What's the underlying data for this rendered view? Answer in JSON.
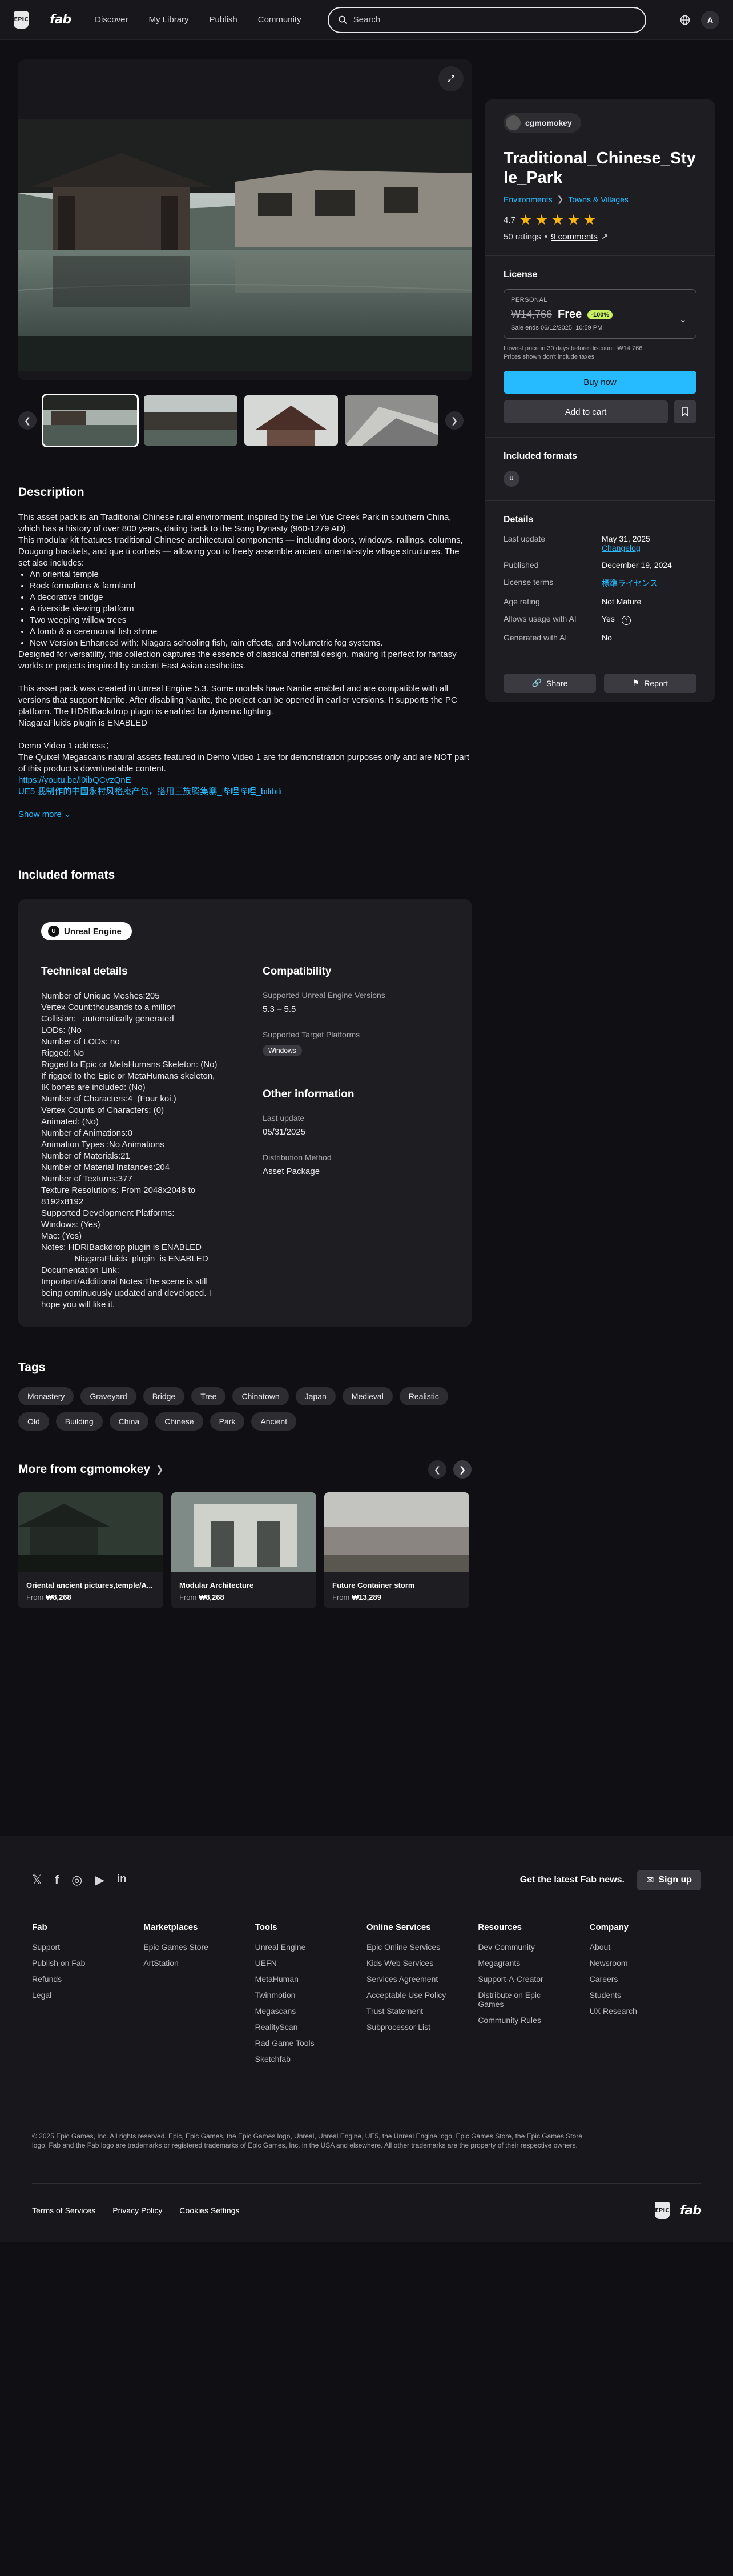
{
  "header": {
    "epic_logo_text": "EPIC",
    "fab_logo_text": "fab",
    "nav": [
      "Discover",
      "My Library",
      "Publish",
      "Community"
    ],
    "search_placeholder": "Search",
    "avatar_letter": "A"
  },
  "gallery": {
    "expand_icon": "expand-icon"
  },
  "description": {
    "title": "Description",
    "p1": "This asset pack is an Traditional Chinese rural environment, inspired by the Lei Yue Creek Park in southern China, which has a history of over 800 years, dating back to the Song Dynasty (960-1279 AD).",
    "p2": "This modular kit features traditional Chinese architectural components — including doors, windows, railings, columns, Dougong brackets, and que ti corbels — allowing you to freely assemble ancient oriental-style village structures. The set also includes:",
    "bullets": [
      "An oriental temple",
      "Rock formations & farmland",
      "A decorative bridge",
      "A riverside viewing platform",
      "Two weeping willow trees",
      "A tomb & a ceremonial fish shrine",
      "New Version Enhanced with: Niagara schooling fish, rain effects, and volumetric fog systems."
    ],
    "p3": "Designed for versatility, this collection captures the essence of classical oriental design, making it perfect for fantasy worlds or projects inspired by ancient East Asian aesthetics.",
    "p4": "This asset pack was created in Unreal Engine 5.3. Some models have Nanite enabled and are compatible with all versions that support Nanite. After disabling Nanite, the project can be opened in earlier versions. It supports the PC platform. The HDRIBackdrop plugin is enabled for dynamic lighting.",
    "p5": "NiagaraFluids  plugin  is ENABLED",
    "p6": "Demo Video 1 address：",
    "p7": " The Quixel Megascans natural assets featured in Demo Video 1 are for demonstration purposes only and are NOT part of this product's downloadable content.",
    "link1": "https://youtu.be/l0ibQCvzQnE",
    "link2": "UE5 我制作的中国永村风格庵产包，搭用三族腾集寨_哔哩哔哩_bilibili",
    "show_more": "Show more"
  },
  "included": {
    "title": "Included formats",
    "engine": "Unreal Engine",
    "engine_icon_text": "U",
    "tech_title": "Technical details",
    "tech_text": "Number of Unique Meshes:205\nVertex Count:thousands to a million\nCollision:   automatically generated\nLODs: (No\nNumber of LODs: no\nRigged: No\nRigged to Epic or MetaHumans Skeleton: (No)\nIf rigged to the Epic or MetaHumans skeleton, IK bones are included: (No)\nNumber of Characters:4  (Four koi.)\nVertex Counts of Characters: (0)\nAnimated: (No)\nNumber of Animations:0\nAnimation Types :No Animations\nNumber of Materials:21\nNumber of Material Instances:204\nNumber of Textures:377\nTexture Resolutions: From 2048x2048 to 8192x8192\nSupported Development Platforms:\nWindows: (Yes)\nMac: (Yes)\nNotes: HDRIBackdrop plugin is ENABLED\n              NiagaraFluids  plugin  is ENABLED\nDocumentation Link:\nImportant/Additional Notes:The scene is still being continuously updated and developed. I hope you will like it.",
    "compat_title": "Compatibility",
    "ue_versions_label": "Supported Unreal Engine Versions",
    "ue_versions": "5.3 – 5.5",
    "platforms_label": "Supported Target Platforms",
    "platform": "Windows",
    "other_title": "Other information",
    "last_update_label": "Last update",
    "last_update": "05/31/2025",
    "distribution_label": "Distribution Method",
    "distribution": "Asset Package"
  },
  "tags": {
    "title": "Tags",
    "items": [
      "Monastery",
      "Graveyard",
      "Bridge",
      "Tree",
      "Chinatown",
      "Japan",
      "Medieval",
      "Realistic",
      "Old",
      "Building",
      "China",
      "Chinese",
      "Park",
      "Ancient"
    ]
  },
  "more": {
    "title": "More from cgmomokey",
    "cards": [
      {
        "title": "Oriental ancient pictures,temple/A...",
        "from": "From",
        "price": "₩8,268"
      },
      {
        "title": "Modular Architecture",
        "from": "From",
        "price": "₩8,268"
      },
      {
        "title": "Future Container storm",
        "from": "From",
        "price": "₩13,289"
      }
    ]
  },
  "product": {
    "seller": "cgmomokey",
    "title": "Traditional_Chinese_Style_Park",
    "breadcrumb": [
      "Environments",
      "Towns & Villages"
    ],
    "rating": "4.7",
    "stars": 5,
    "ratings_count": "50 ratings",
    "dot": "•",
    "comments": "9 comments"
  },
  "license": {
    "title": "License",
    "label": "PERSONAL",
    "old_price": "₩14,766",
    "price": "Free",
    "discount": "-100%",
    "sale_end": "Sale ends 06/12/2025, 10:59 PM",
    "note1": "Lowest price in 30 days before discount: ₩14,766",
    "note2": "Prices shown don't include taxes",
    "buy": "Buy now",
    "cart": "Add to cart"
  },
  "formats": {
    "title": "Included formats",
    "icon_text": "U"
  },
  "details": {
    "title": "Details",
    "rows": [
      {
        "k": "Last update",
        "v": "May 31, 2025",
        "link": "Changelog"
      },
      {
        "k": "Published",
        "v": "December 19, 2024"
      },
      {
        "k": "License terms",
        "link": "標準ライセンス"
      },
      {
        "k": "Age rating",
        "v": "Not Mature"
      },
      {
        "k": "Allows usage with AI",
        "v": "Yes"
      },
      {
        "k": "Generated with AI",
        "v": "No"
      }
    ],
    "share": "Share",
    "report": "Report"
  },
  "footer": {
    "newsletter": "Get the latest Fab news.",
    "signup": "Sign up",
    "columns": [
      {
        "title": "Fab",
        "items": [
          "Support",
          "Publish on Fab",
          "Refunds",
          "Legal"
        ]
      },
      {
        "title": "Marketplaces",
        "items": [
          "Epic Games Store",
          "ArtStation"
        ]
      },
      {
        "title": "Tools",
        "items": [
          "Unreal Engine",
          "UEFN",
          "MetaHuman",
          "Twinmotion",
          "Megascans",
          "RealityScan",
          "Rad Game Tools",
          "Sketchfab"
        ]
      },
      {
        "title": "Online Services",
        "items": [
          "Epic Online Services",
          "Kids Web Services",
          "Services Agreement",
          "Acceptable Use Policy",
          "Trust Statement",
          "Subprocessor List"
        ]
      },
      {
        "title": "Resources",
        "items": [
          "Dev Community",
          "Megagrants",
          "Support-A-Creator",
          "Distribute on Epic Games",
          "Community Rules"
        ]
      },
      {
        "title": "Company",
        "items": [
          "About",
          "Newsroom",
          "Careers",
          "Students",
          "UX Research"
        ]
      }
    ],
    "legal": "© 2025 Epic Games, Inc. All rights reserved. Epic, Epic Games, the Epic Games logo, Unreal, Unreal Engine, UE5, the Unreal Engine logo, Epic Games Store, the Epic Games Store logo, Fab and the Fab logo are trademarks or registered trademarks of Epic Games, Inc. in the USA and elsewhere. All other trademarks are the property of their respective owners.",
    "bottom_links": [
      "Terms of Services",
      "Privacy Policy",
      "Cookies Settings"
    ],
    "epic_logo_text": "EPIC",
    "fab_logo_text": "fab"
  }
}
